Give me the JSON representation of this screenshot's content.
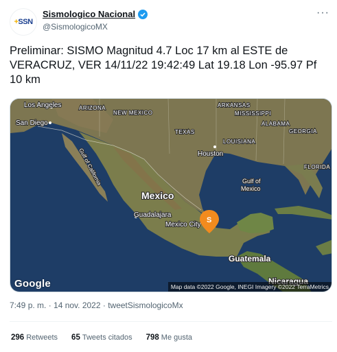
{
  "account": {
    "display_name": "Sismologico Nacional",
    "handle": "@SismologicoMX",
    "avatar_text": "SSN"
  },
  "tweet": {
    "text": "Preliminar: SISMO Magnitud 4.7 Loc  17 km al ESTE de VERACRUZ, VER 14/11/22 19:42:49 Lat 19.18 Lon -95.97 Pf 10 km",
    "more_label": "···"
  },
  "map": {
    "labels": {
      "los_angeles": "Los Angeles",
      "san_diego": "San Diego",
      "arizona": "ARIZONA",
      "new_mexico": "NEW MEXICO",
      "arkansas": "ARKANSAS",
      "mississippi": "MISSISSIPPI",
      "alabama": "ALABAMA",
      "georgia": "GEORGIA",
      "texas": "TEXAS",
      "louisiana": "LOUISIANA",
      "houston": "Houston",
      "florida": "FLORIDA",
      "gulf_of_california": "Gulf of California",
      "gulf_of_mexico_1": "Gulf of",
      "gulf_of_mexico_2": "Mexico",
      "mexico": "Mexico",
      "guadalajara": "Guadalajara",
      "mexico_city": "Mexico City",
      "guatemala": "Guatemala",
      "nicaragua": "Nicaragua",
      "marker_letter": "S"
    },
    "google": "Google",
    "attribution": "Map data ©2022 Google, INEGI Imagery ©2022 TerraMetrics"
  },
  "meta": {
    "timestamp": "7:49 p. m. · 14 nov. 2022 · tweetSismologicoMx"
  },
  "stats": {
    "retweets_count": "296",
    "retweets_label": "Retweets",
    "quotes_count": "65",
    "quotes_label": "Tweets citados",
    "likes_count": "798",
    "likes_label": "Me gusta"
  },
  "colors": {
    "verified": "#1d9bf0",
    "marker": "#f28b1e",
    "ocean": "#1c3f6e",
    "land": "#7a7a55"
  }
}
